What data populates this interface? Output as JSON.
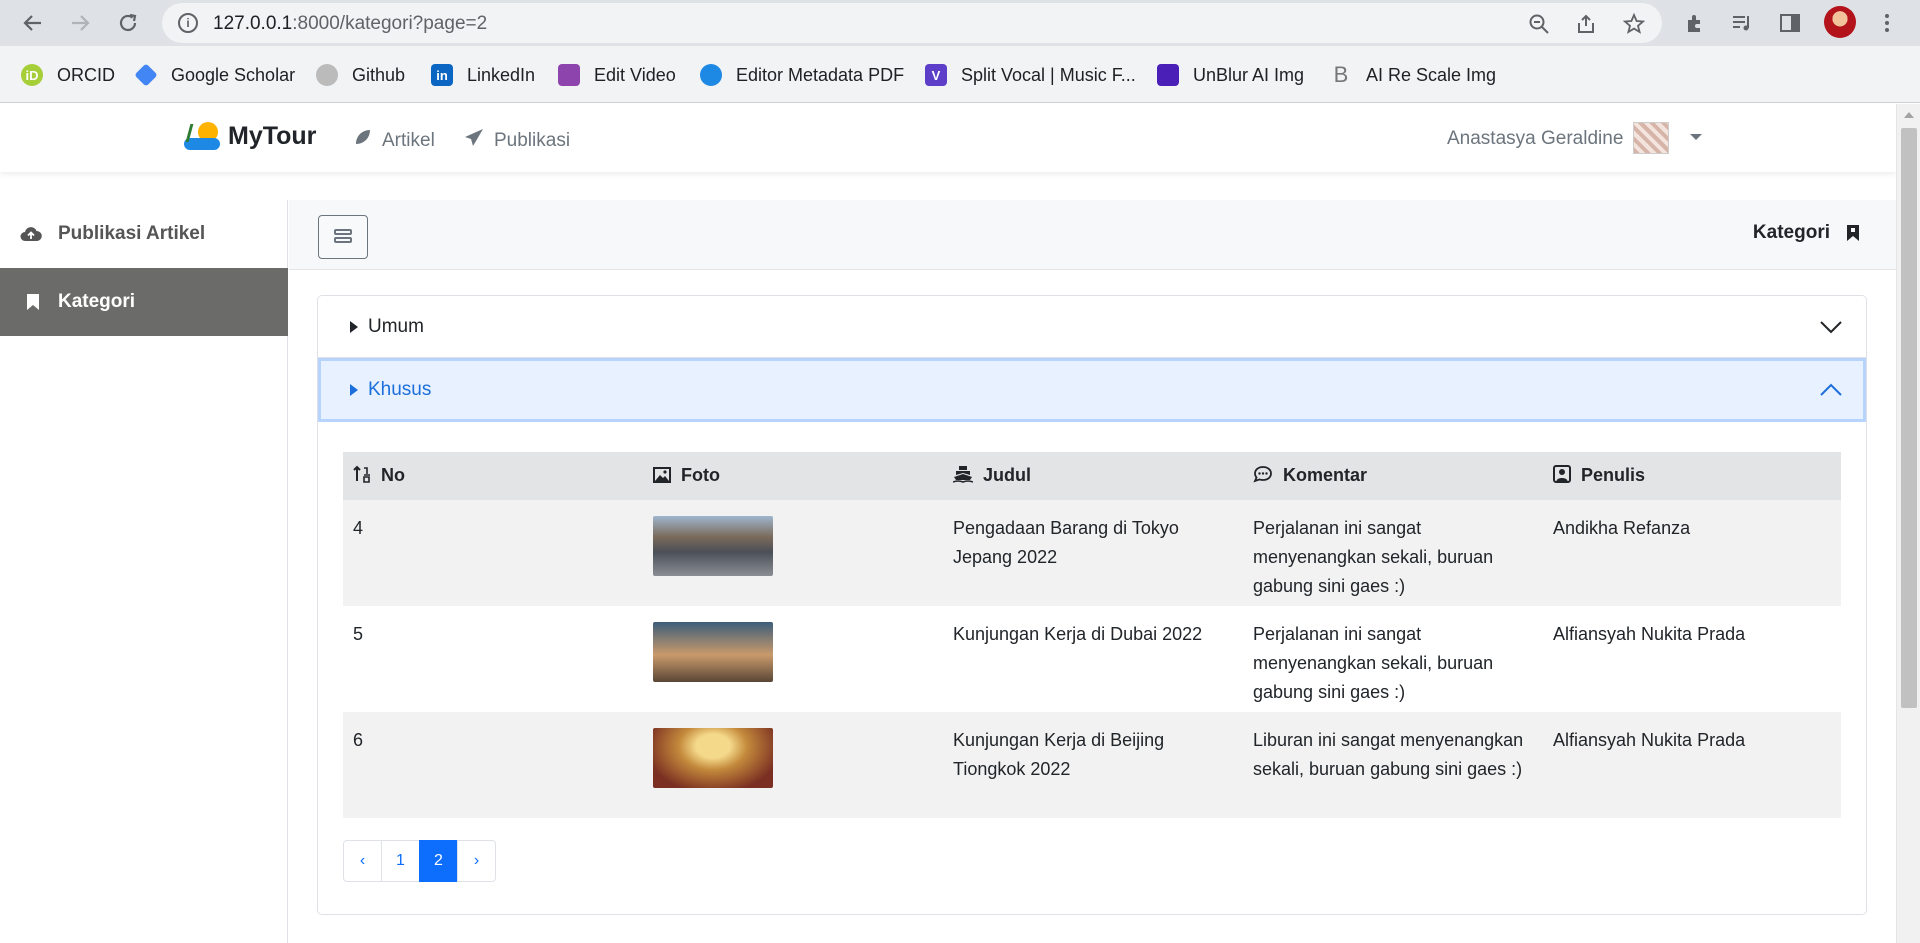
{
  "browser": {
    "url_host": "127.0.0.1",
    "url_rest": ":8000/kategori?page=2",
    "bookmarks": [
      {
        "label": "ORCID",
        "icon": "orcid-icon",
        "color": "#a6ce39"
      },
      {
        "label": "Google Scholar",
        "icon": "google-scholar-icon",
        "color": "#4285f4"
      },
      {
        "label": "Github",
        "icon": "github-icon",
        "color": "#bbbbbb"
      },
      {
        "label": "LinkedIn",
        "icon": "linkedin-icon",
        "color": "#0a66c2"
      },
      {
        "label": "Edit Video",
        "icon": "clapper-icon",
        "color": "#8e44ad"
      },
      {
        "label": "Editor Metadata PDF",
        "icon": "people-icon",
        "color": "#1e88e5"
      },
      {
        "label": "Split Vocal | Music F...",
        "icon": "v-icon",
        "color": "#5c3ec9"
      },
      {
        "label": "UnBlur AI Img",
        "icon": "unblur-icon",
        "color": "#4a1fb8"
      },
      {
        "label": "AI Re Scale Img",
        "icon": "b-icon",
        "color": "#777777"
      }
    ]
  },
  "navbar": {
    "brand": "MyTour",
    "links": [
      {
        "label": "Artikel",
        "icon": "feather-icon"
      },
      {
        "label": "Publikasi",
        "icon": "paper-plane-icon"
      }
    ],
    "user_name": "Anastasya Geraldine"
  },
  "sidebar": {
    "items": [
      {
        "label": "Publikasi Artikel",
        "icon": "cloud-upload-icon",
        "active": false
      },
      {
        "label": "Kategori",
        "icon": "bookmark-icon",
        "active": true
      }
    ]
  },
  "header": {
    "title": "Kategori"
  },
  "accordion": {
    "sections": [
      {
        "label": "Umum",
        "expanded": false
      },
      {
        "label": "Khusus",
        "expanded": true
      }
    ]
  },
  "table": {
    "columns": [
      "No",
      "Foto",
      "Judul",
      "Komentar",
      "Penulis"
    ],
    "rows": [
      {
        "no": "4",
        "photo": "tokyo-street-photo",
        "judul": "Pengadaan Barang di Tokyo Jepang 2022",
        "komentar": "Perjalanan ini sangat menyenangkan sekali, buruan gabung sini gaes :)",
        "penulis": "Andikha Refanza"
      },
      {
        "no": "5",
        "photo": "dubai-skyline-photo",
        "judul": "Kunjungan Kerja di Dubai 2022",
        "komentar": "Perjalanan ini sangat menyenangkan sekali, buruan gabung sini gaes :)",
        "penulis": "Alfiansyah Nukita Prada"
      },
      {
        "no": "6",
        "photo": "beijing-hall-photo",
        "judul": "Kunjungan Kerja di Beijing Tiongkok 2022",
        "komentar": "Liburan ini sangat menyenangkan sekali, buruan gabung sini gaes :)",
        "penulis": "Alfiansyah Nukita Prada"
      }
    ]
  },
  "pagination": {
    "prev": "‹",
    "pages": [
      "1",
      "2"
    ],
    "current": "2",
    "next": "›"
  },
  "colors": {
    "primary": "#0d6efd",
    "sidebar_active": "#6b6c6a",
    "accordion_active_bg": "#e7f1ff"
  }
}
